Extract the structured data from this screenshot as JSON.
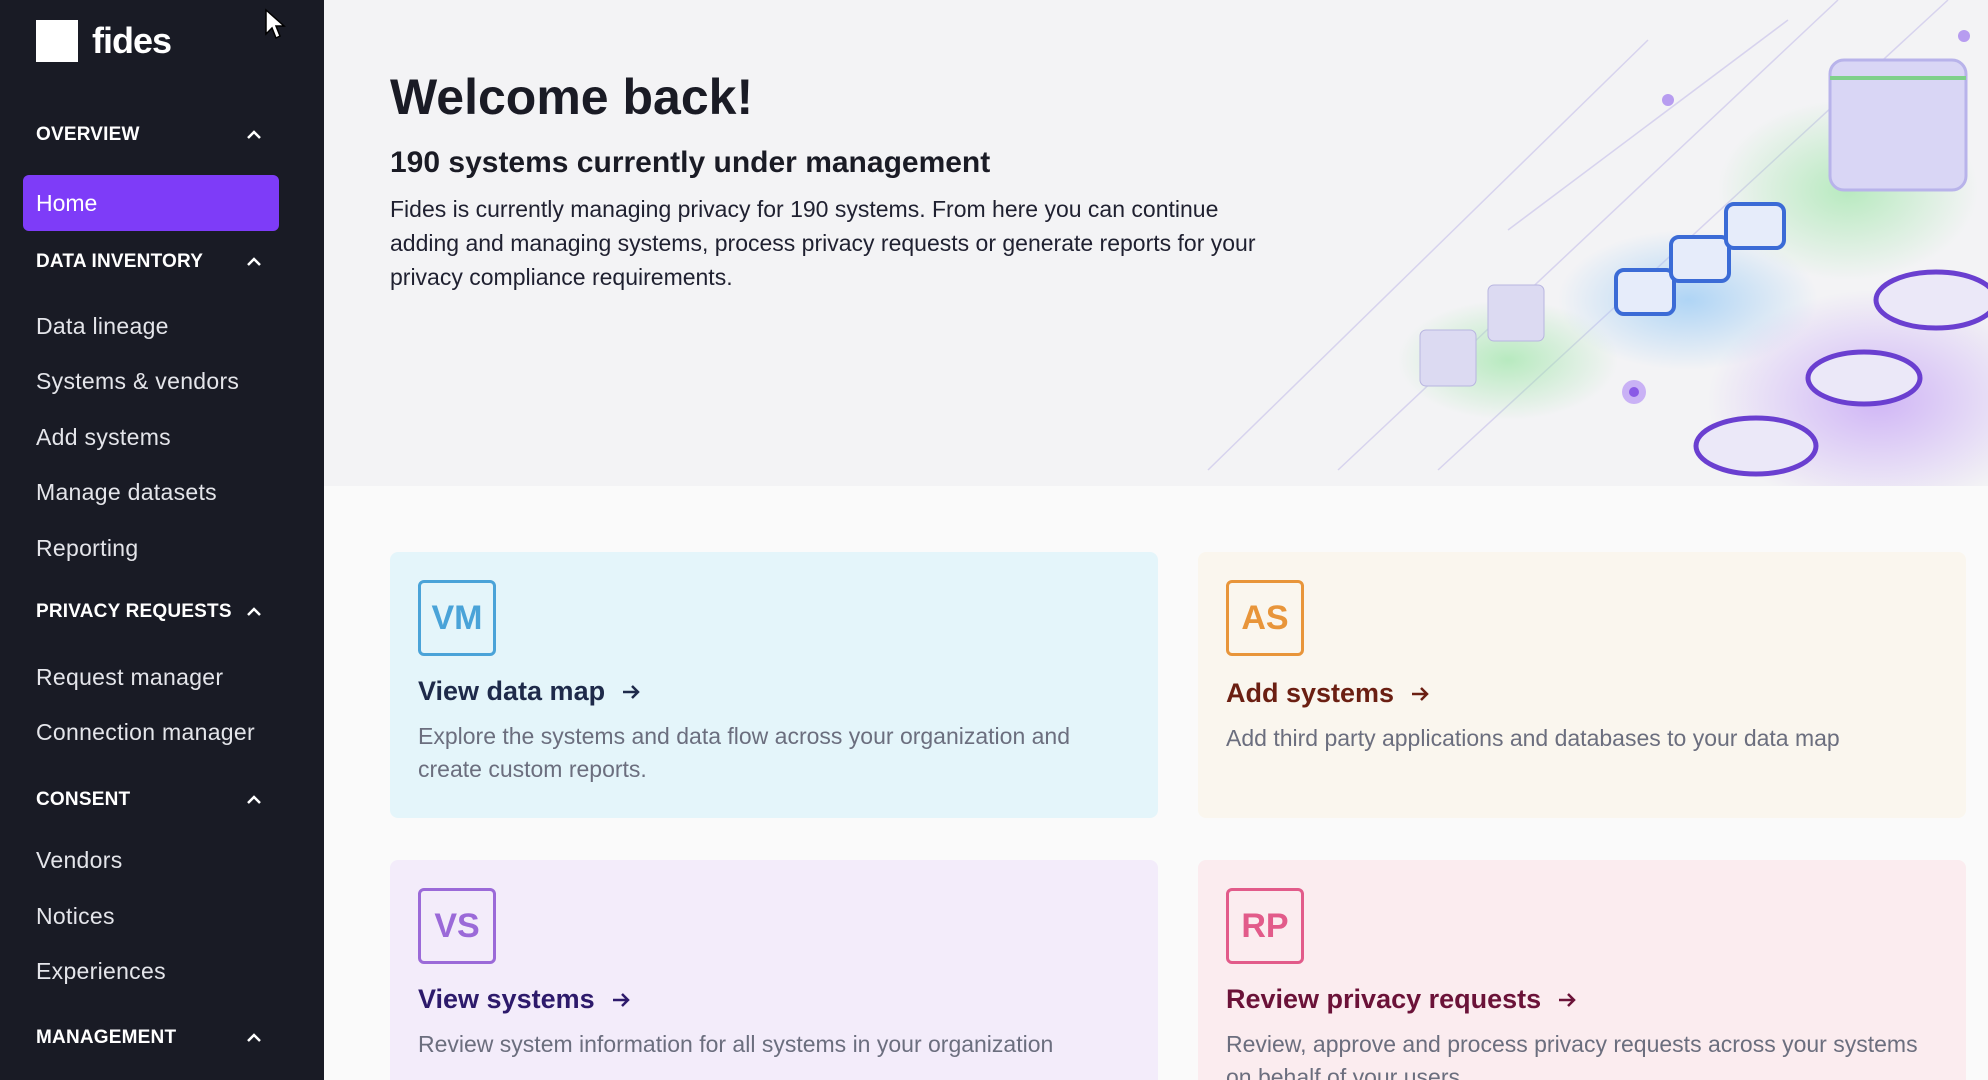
{
  "app": {
    "name": "fides"
  },
  "sidebar": {
    "sections": [
      {
        "label": "OVERVIEW",
        "items": [
          "Home"
        ]
      },
      {
        "label": "DATA INVENTORY",
        "items": [
          "Data lineage",
          "Systems & vendors",
          "Add systems",
          "Manage datasets",
          "Reporting"
        ]
      },
      {
        "label": "PRIVACY REQUESTS",
        "items": [
          "Request manager",
          "Connection manager"
        ]
      },
      {
        "label": "CONSENT",
        "items": [
          "Vendors",
          "Notices",
          "Experiences"
        ]
      },
      {
        "label": "MANAGEMENT",
        "items": []
      }
    ],
    "active_item": "Home"
  },
  "hero": {
    "title": "Welcome back!",
    "subtitle": "190 systems currently under management",
    "description": "Fides is currently managing privacy for 190 systems. From here you can continue adding and managing systems, process privacy requests or generate reports for your privacy compliance requirements."
  },
  "cards": [
    {
      "badge": "VM",
      "title": "View data map",
      "description": "Explore the systems and data flow across your organization and create custom reports.",
      "color": "#4aa3d8",
      "title_color": "#1e2a4a"
    },
    {
      "badge": "AS",
      "title": "Add systems",
      "description": "Add third party applications and databases to your data map",
      "color": "#e8953a",
      "title_color": "#6b1f12"
    },
    {
      "badge": "VS",
      "title": "View systems",
      "description": "Review system information for all systems in your organization",
      "color": "#9b6ad8",
      "title_color": "#2d1a6b"
    },
    {
      "badge": "RP",
      "title": "Review privacy requests",
      "description": "Review, approve and process privacy requests across your systems on behalf of your users.",
      "color": "#e25b8a",
      "title_color": "#6b1238"
    }
  ],
  "colors": {
    "sidebar_bg": "#191b25",
    "accent": "#7e3cf8"
  }
}
